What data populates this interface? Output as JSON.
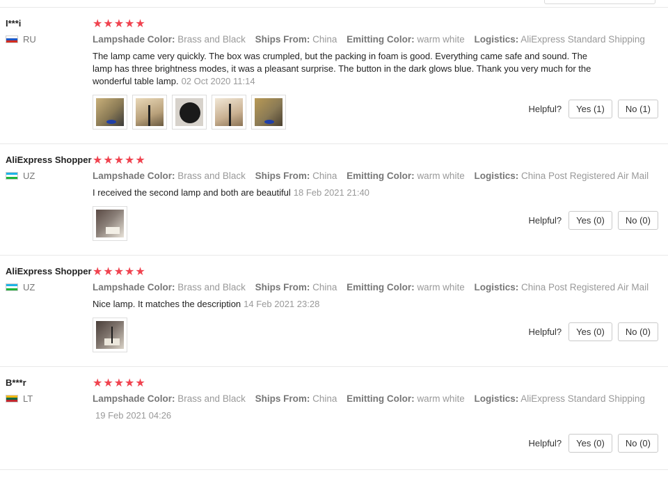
{
  "labels": {
    "lampshade": "Lampshade Color:",
    "ships": "Ships From:",
    "emitting": "Emitting Color:",
    "logistics": "Logistics:",
    "helpful": "Helpful?"
  },
  "reviews": [
    {
      "user": "I***i",
      "country": "RU",
      "flag_colors": [
        "#ffffff",
        "#1c57c7",
        "#d52b1e"
      ],
      "stars": "★★★★★",
      "lampshade": "Brass and Black",
      "ships": "China",
      "emitting": "warm white",
      "logistics": "AliExpress Standard Shipping",
      "text": "The lamp came very quickly. The box was crumpled, but the packing in foam is good. Everything came safe and sound. The lamp has three brightness modes, it was a pleasant surprise. The button in the dark glows blue. Thank you very much for the wonderful table lamp.",
      "date": "02 Oct 2020 11:14",
      "yes": "Yes (1)",
      "no": "No (1)"
    },
    {
      "user": "AliExpress Shopper",
      "country": "UZ",
      "flag_colors": [
        "#1eb4e6",
        "#ffffff",
        "#1eb53a"
      ],
      "stars": "★★★★★",
      "lampshade": "Brass and Black",
      "ships": "China",
      "emitting": "warm white",
      "logistics": "China Post Registered Air Mail",
      "text": "I received the second lamp and both are beautiful",
      "date": "18 Feb 2021 21:40",
      "yes": "Yes (0)",
      "no": "No (0)"
    },
    {
      "user": "AliExpress Shopper",
      "country": "UZ",
      "flag_colors": [
        "#1eb4e6",
        "#ffffff",
        "#1eb53a"
      ],
      "stars": "★★★★★",
      "lampshade": "Brass and Black",
      "ships": "China",
      "emitting": "warm white",
      "logistics": "China Post Registered Air Mail",
      "text": "Nice lamp. It matches the description",
      "date": "14 Feb 2021 23:28",
      "yes": "Yes (0)",
      "no": "No (0)"
    },
    {
      "user": "B***r",
      "country": "LT",
      "flag_colors": [
        "#fdb913",
        "#006a44",
        "#c1272d"
      ],
      "stars": "★★★★★",
      "lampshade": "Brass and Black",
      "ships": "China",
      "emitting": "warm white",
      "logistics": "AliExpress Standard Shipping",
      "text": "",
      "date": "19 Feb 2021 04:26",
      "yes": "Yes (0)",
      "no": "No (0)"
    }
  ]
}
